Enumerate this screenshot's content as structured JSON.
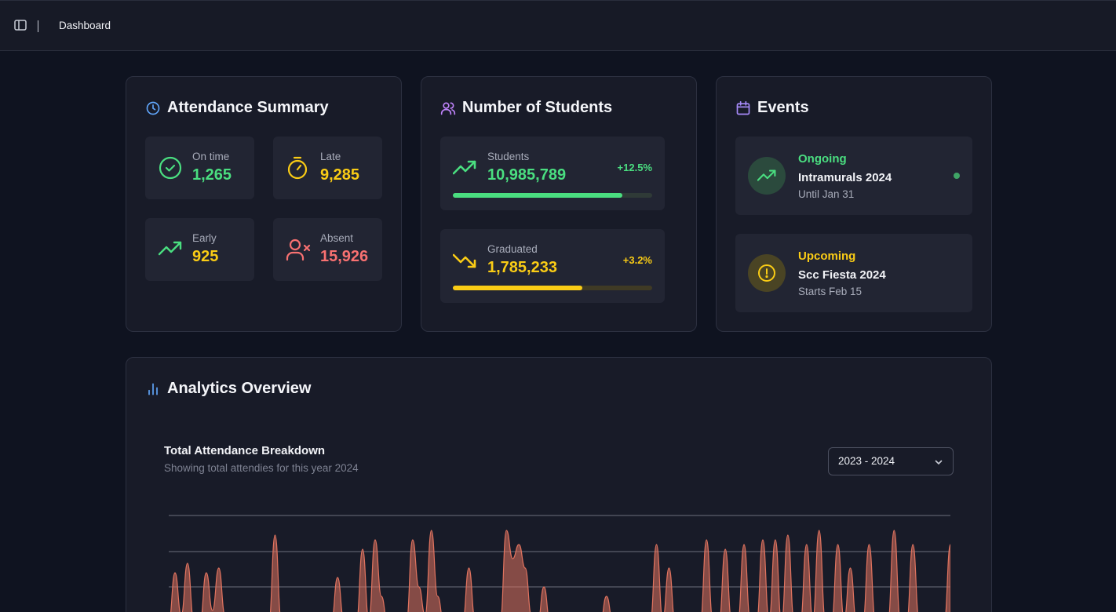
{
  "header": {
    "breadcrumb": "Dashboard",
    "toggle_icon": "sidebar-toggle-icon"
  },
  "attendance": {
    "title": "Attendance Summary",
    "icon": "clock-icon",
    "items": [
      {
        "label": "On time",
        "value": "1,265",
        "icon": "check-circle-icon",
        "color": "#4ade80"
      },
      {
        "label": "Late",
        "value": "9,285",
        "icon": "stopwatch-icon",
        "color": "#facc15"
      },
      {
        "label": "Early",
        "value": "925",
        "icon": "trending-up-icon",
        "color": "#facc15"
      },
      {
        "label": "Absent",
        "value": "15,926",
        "icon": "user-x-icon",
        "color": "#f87171"
      }
    ]
  },
  "students": {
    "title": "Number of Students",
    "icon": "users-icon",
    "items": [
      {
        "label": "Students",
        "value": "10,985,789",
        "change": "+12.5%",
        "progress": 0.85,
        "color": "#4ade80"
      },
      {
        "label": "Graduated",
        "value": "1,785,233",
        "change": "+3.2%",
        "progress": 0.65,
        "color": "#facc15"
      }
    ]
  },
  "events": {
    "title": "Events",
    "icon": "calendar-icon",
    "items": [
      {
        "status": "Ongoing",
        "name": "Intramurals 2024",
        "date": "Until Jan 31",
        "color": "#4ade80"
      },
      {
        "status": "Upcoming",
        "name": "Scc Fiesta 2024",
        "date": "Starts Feb 15",
        "color": "#facc15"
      }
    ]
  },
  "analytics": {
    "title": "Analytics Overview",
    "icon": "bar-chart-icon",
    "chart_title": "Total Attendance Breakdown",
    "chart_subtitle": "Showing total attendies for this year 2024",
    "year_select": "2023 - 2024"
  },
  "chart_data": {
    "type": "area",
    "grid": true,
    "series": [
      {
        "color": "#e0735f",
        "values": [
          0.02,
          0.55,
          0.1,
          0.65,
          0.05,
          0.02,
          0.55,
          0.15,
          0.6,
          0.1,
          0.04,
          0.02,
          0.02,
          0.02,
          0.02,
          0.02,
          0.02,
          0.95,
          0.05,
          0.02,
          0.02,
          0.02,
          0.02,
          0.02,
          0.02,
          0.02,
          0.02,
          0.5,
          0.05,
          0.02,
          0.02,
          0.8,
          0.05,
          0.9,
          0.3,
          0.02,
          0.02,
          0.02,
          0.02,
          0.9,
          0.4,
          0.1,
          1.0,
          0.3,
          0.02,
          0.02,
          0.02,
          0.02,
          0.6,
          0.05,
          0.02,
          0.02,
          0.02,
          0.02,
          1.0,
          0.7,
          0.85,
          0.6,
          0.1,
          0.02,
          0.4,
          0.02,
          0.02,
          0.02,
          0.02,
          0.02,
          0.02,
          0.02,
          0.02,
          0.02,
          0.3,
          0.05,
          0.02,
          0.02,
          0.02,
          0.02,
          0.02,
          0.02,
          0.85,
          0.05,
          0.6,
          0.02,
          0.02,
          0.02,
          0.02,
          0.02,
          0.9,
          0.05,
          0.02,
          0.8,
          0.05,
          0.02,
          0.85,
          0.05,
          0.02,
          0.9,
          0.05,
          0.9,
          0.02,
          0.95,
          0.05,
          0.02,
          0.85,
          0.05,
          1.0,
          0.05,
          0.02,
          0.85,
          0.05,
          0.6,
          0.02,
          0.02,
          0.85,
          0.05,
          0.02,
          0.02,
          1.0,
          0.05,
          0.02,
          0.85,
          0.05,
          0.02,
          0.02,
          0.02,
          0.02,
          0.85
        ]
      },
      {
        "color": "#2a9d8f",
        "values": [
          0.02,
          0.02,
          0.02,
          0.02,
          0.02,
          0.02,
          0.02,
          0.02,
          0.02,
          0.02,
          0.02,
          0.02,
          0.02,
          0.02,
          0.02,
          0.02,
          0.02,
          0.02,
          0.02,
          0.02,
          0.02,
          0.02,
          0.02,
          0.02,
          0.02,
          0.02,
          0.02,
          0.02,
          0.02,
          0.02,
          0.02,
          0.02,
          0.02,
          0.02,
          0.02,
          0.02,
          0.02,
          0.02,
          0.02,
          0.02,
          0.02,
          0.02,
          0.02,
          0.02,
          0.02,
          0.02,
          0.02,
          0.02,
          0.02,
          0.02,
          0.02,
          0.02,
          0.02,
          0.02,
          0.02,
          0.02,
          0.02,
          0.02,
          0.02,
          0.02,
          0.02,
          0.02,
          0.02,
          0.02,
          0.02,
          0.02,
          0.02,
          0.02,
          0.02,
          0.02,
          0.02,
          0.02,
          0.02,
          0.02,
          0.02,
          0.02,
          0.02,
          0.02,
          0.02,
          0.02,
          0.02,
          0.02,
          0.02,
          0.02,
          0.02,
          0.02,
          0.02,
          0.02,
          0.02,
          0.02,
          0.02,
          0.02,
          0.02,
          0.02,
          0.02,
          0.02,
          0.02,
          0.02,
          0.02,
          0.02,
          0.02,
          0.02,
          0.02,
          0.02,
          0.02,
          0.02,
          0.02,
          0.02,
          0.02,
          0.02,
          0.02,
          0.02,
          0.02,
          0.02,
          0.02,
          0.02,
          0.02,
          0.02,
          0.02,
          0.02,
          0.02,
          0.02,
          0.02,
          0.02,
          0.02,
          0.02
        ]
      }
    ]
  }
}
